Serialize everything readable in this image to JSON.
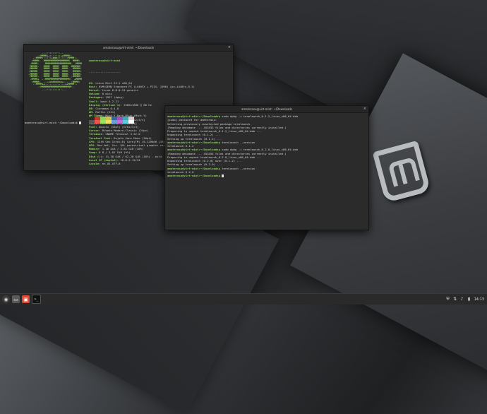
{
  "desktop": {
    "background": "#2a2c2f",
    "accent": "#8bd65b"
  },
  "terminal_left": {
    "title": "amaterasu@virt-mint: ~/Downloads",
    "user_host": "amaterasu@virt-mint",
    "separator": "-------------------",
    "info_lines": [
      {
        "key": "OS:",
        "value": " Linux Mint 22.1 x86_64"
      },
      {
        "key": "Host:",
        "value": " KVM/QEMU Standard PC (i440FX + PIIX, 1996) (pc-i440fx-9.2)"
      },
      {
        "key": "Kernel:",
        "value": " Linux 6.8.0-51-generic"
      },
      {
        "key": "Uptime:",
        "value": " 0 mins"
      },
      {
        "key": "Packages:",
        "value": " 1927 (dpkg)"
      },
      {
        "key": "Shell:",
        "value": " bash 5.2.21"
      },
      {
        "key": "Display (Virtual-1):",
        "value": " 2560x1600 @ 60 Hz"
      },
      {
        "key": "DE:",
        "value": " Cinnamon 6.4.8"
      },
      {
        "key": "WM:",
        "value": " Muffin (X11)"
      },
      {
        "key": "WM Theme:",
        "value": " Mint-Y-Dark-Blue (Mint-Y)"
      },
      {
        "key": "Theme:",
        "value": " Mint-Y-Dark-Blue [GTK2/3/4]"
      },
      {
        "key": "Icons:",
        "value": " Mint-Y-Blue [GTK2/3/4]"
      },
      {
        "key": "Font:",
        "value": " Ubuntu (10pt) [GTK2/3/4]"
      },
      {
        "key": "Cursor:",
        "value": " Bibata-Modern-Classic (24px)"
      },
      {
        "key": "Terminal:",
        "value": " GNOME Terminal 3.52.0"
      },
      {
        "key": "Terminal Font:",
        "value": " DejaVu Sans Mono (10pt)"
      },
      {
        "key": "CPU:",
        "value": " 12th Gen Intel(R) Core(TM) i9-12900H (16) @"
      },
      {
        "key": "GPU:",
        "value": " Red Hat, Inc. QXL paravirtual graphic card"
      },
      {
        "key": "Memory:",
        "value": " 1.16 GiB / 3.82 GiB (30%)"
      },
      {
        "key": "Swap:",
        "value": " 0 B / 3.81 GiB (0%)"
      },
      {
        "key": "Disk (/):",
        "value": " 11.38 GiB / 62.28 GiB (18%) - ext4"
      },
      {
        "key": "Local IP (enp1s0):",
        "value": " 10.0.2.15/24"
      },
      {
        "key": "Locale:",
        "value": " en_US.UTF-8"
      }
    ],
    "ascii_art": "          ...-::::::-...\n       .-MMMM++:::::::++MMMM-.\n    .:MMMM::::::+mmm/::::::MMMM:.\n   :MMMM.  MMMMMMMMMMMMMMMMM  MMMM:\n  .MMMM.   .MMMMMMMMMMMMMMMMM. .MMMM\n  MMMMM.   MMMM  MMMM  MMMM  MMMMMM\n .MMMMM    MMMM  MMMM  MMMM   MMMMM.\n .MMMMM    MMMM  MMMM  MMMM   MMMMM.\n .MMMMM    MMMM  MMMM  MMMM   MMMMM.\n  MMMMM.   MMMM  MMMM  MMMM  .MMMMM\n  .MMMM+  .:MMMMMMMMMMMMMMMM:  +MMMM\n   :MMMM:  ..:+ohhhhhho+:..  :MMMM:\n    .:MMMM++.............++MMMM:.\n       .-MMMMMMMMMMMMMMMMMMMM-.\n          ...-::::::::-...",
    "prompt": "amaterasu@virt-mint:~/Downloads$ "
  },
  "terminal_right": {
    "title": "amaterasu@virt-mint: ~/Downloads",
    "lines": [
      {
        "prompt": "amaterasu@virt-mint:~/Downloads$ ",
        "text": "sudo dpkg -i termlaunch_0.1.2_linux_x86_64.deb"
      },
      {
        "prompt": "",
        "text": "[sudo] password for amaterasu:"
      },
      {
        "prompt": "",
        "text": "Selecting previously unselected package termlaunch."
      },
      {
        "prompt": "",
        "text": "(Reading database ... 453433 files and directories currently installed.)"
      },
      {
        "prompt": "",
        "text": "Preparing to unpack termlaunch_0.1.2_linux_x86_64.deb ..."
      },
      {
        "prompt": "",
        "text": "Unpacking termlaunch (0.1.2) ..."
      },
      {
        "prompt": "",
        "text": "Setting up termlaunch (0.1.2) ..."
      },
      {
        "prompt": "amaterasu@virt-mint:~/Downloads$ ",
        "text": "termlaunch --version"
      },
      {
        "prompt": "",
        "text": "termlaunch 0.1.2"
      },
      {
        "prompt": "amaterasu@virt-mint:~/Downloads$ ",
        "text": "sudo dpkg -i termlaunch_0.2.0_linux_x86_64.deb"
      },
      {
        "prompt": "",
        "text": "(Reading database ... 453454 files and directories currently installed.)"
      },
      {
        "prompt": "",
        "text": "Preparing to unpack termlaunch_0.2.0_linux_x86_64.deb ..."
      },
      {
        "prompt": "",
        "text": "Unpacking termlaunch (0.2.0) over (0.1.2) ..."
      },
      {
        "prompt": "",
        "text": "Setting up termlaunch (0.2.0) ..."
      },
      {
        "prompt": "amaterasu@virt-mint:~/Downloads$ ",
        "text": "termlaunch --version"
      },
      {
        "prompt": "",
        "text": "termlaunch 0.2.0"
      },
      {
        "prompt": "amaterasu@virt-mint:~/Downloads$ ",
        "text": ""
      }
    ]
  },
  "palette": [
    "#2b2b2b",
    "#c0392b",
    "#8bd65b",
    "#d4c14a",
    "#3465a4",
    "#a050b8",
    "#3aa8b8",
    "#d0d0d0"
  ],
  "palette_bright": [
    "#555753",
    "#ef5350",
    "#9ce35f",
    "#f0e060",
    "#6a9fd6",
    "#c070d8",
    "#5ccbd8",
    "#ffffff"
  ],
  "taskbar": {
    "clock": "14:13",
    "menu_icon": "mint-menu-icon",
    "apps": [
      "show-desktop-icon",
      "files-icon",
      "terminal-icon"
    ]
  }
}
